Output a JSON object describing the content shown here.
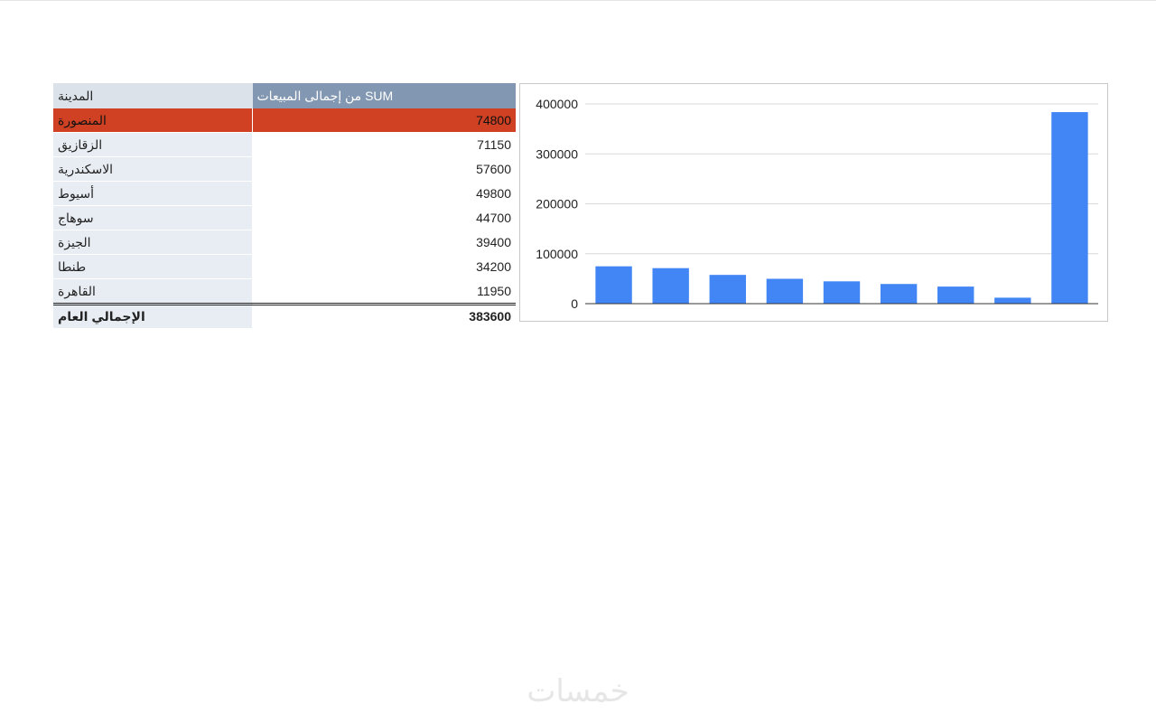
{
  "table": {
    "headers": {
      "city": "المدينة",
      "sum": "SUM من إجمالى المبيعات"
    },
    "rows": [
      {
        "city": "المنصورة",
        "value": "74800"
      },
      {
        "city": "الزقازيق",
        "value": "71150"
      },
      {
        "city": "الاسكندرية",
        "value": "57600"
      },
      {
        "city": "أسيوط",
        "value": "49800"
      },
      {
        "city": "سوهاج",
        "value": "44700"
      },
      {
        "city": "الجيزة",
        "value": "39400"
      },
      {
        "city": "طنطا",
        "value": "34200"
      },
      {
        "city": "القاهرة",
        "value": "11950"
      }
    ],
    "total": {
      "label": "الإجمالي العام",
      "value": "383600"
    },
    "highlight_color": "#cf4122",
    "header_accent_color": "#8297b1"
  },
  "chart_data": {
    "type": "bar",
    "categories": [
      "المنصورة",
      "الزقازيق",
      "الاسكندرية",
      "أسيوط",
      "سوهاج",
      "الجيزة",
      "طنطا",
      "القاهرة",
      "الإجمالي العام"
    ],
    "values": [
      74800,
      71150,
      57600,
      49800,
      44700,
      39400,
      34200,
      11950,
      383600
    ],
    "ylim": [
      0,
      400000
    ],
    "yticks": [
      "0",
      "100000",
      "200000",
      "300000",
      "400000"
    ],
    "show_x_tick_labels": false,
    "grid": true,
    "legend": "none",
    "bar_color": "#4285f4"
  },
  "watermark": {
    "text": "خمسات"
  }
}
